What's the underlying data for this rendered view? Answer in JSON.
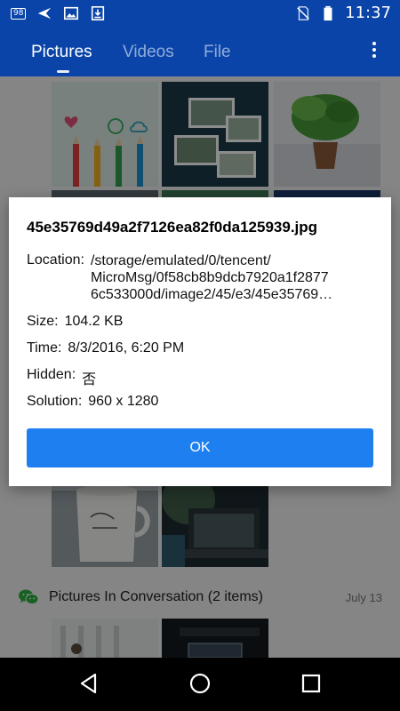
{
  "status_bar": {
    "notification_badge": "98",
    "time": "11:37",
    "icons": [
      "notification-count-icon",
      "send-icon",
      "image-icon",
      "download-icon",
      "no-sim-icon",
      "battery-icon"
    ]
  },
  "tabs": [
    {
      "label": "Pictures",
      "active": true
    },
    {
      "label": "Videos",
      "active": false
    },
    {
      "label": "File",
      "active": false
    }
  ],
  "section": {
    "title": "Pictures In Conversation (2 items)",
    "date": "July 13",
    "icon": "wechat-icon"
  },
  "dialog": {
    "title": "45e35769d49a2f7126ea82f0da125939.jpg",
    "location_label": "Location:",
    "location_lines": [
      "/storage/emulated/0/tencent/",
      "MicroMsg/0f58cb8b9dcb7920a1f2877",
      "6c533000d/image2/45/e3/45e35769…"
    ],
    "size_label": "Size:",
    "size_value": "104.2 KB",
    "time_label": "Time:",
    "time_value": "8/3/2016, 6:20 PM",
    "hidden_label": "Hidden:",
    "hidden_value": "否",
    "solution_label": "Solution:",
    "solution_value": "960 x 1280",
    "ok_label": "OK"
  },
  "colors": {
    "app_bar": "#0a44a8",
    "ok_button": "#1e80f0",
    "wechat": "#2bb140"
  },
  "nav": {
    "icons": [
      "back-icon",
      "home-icon",
      "recents-icon"
    ]
  }
}
